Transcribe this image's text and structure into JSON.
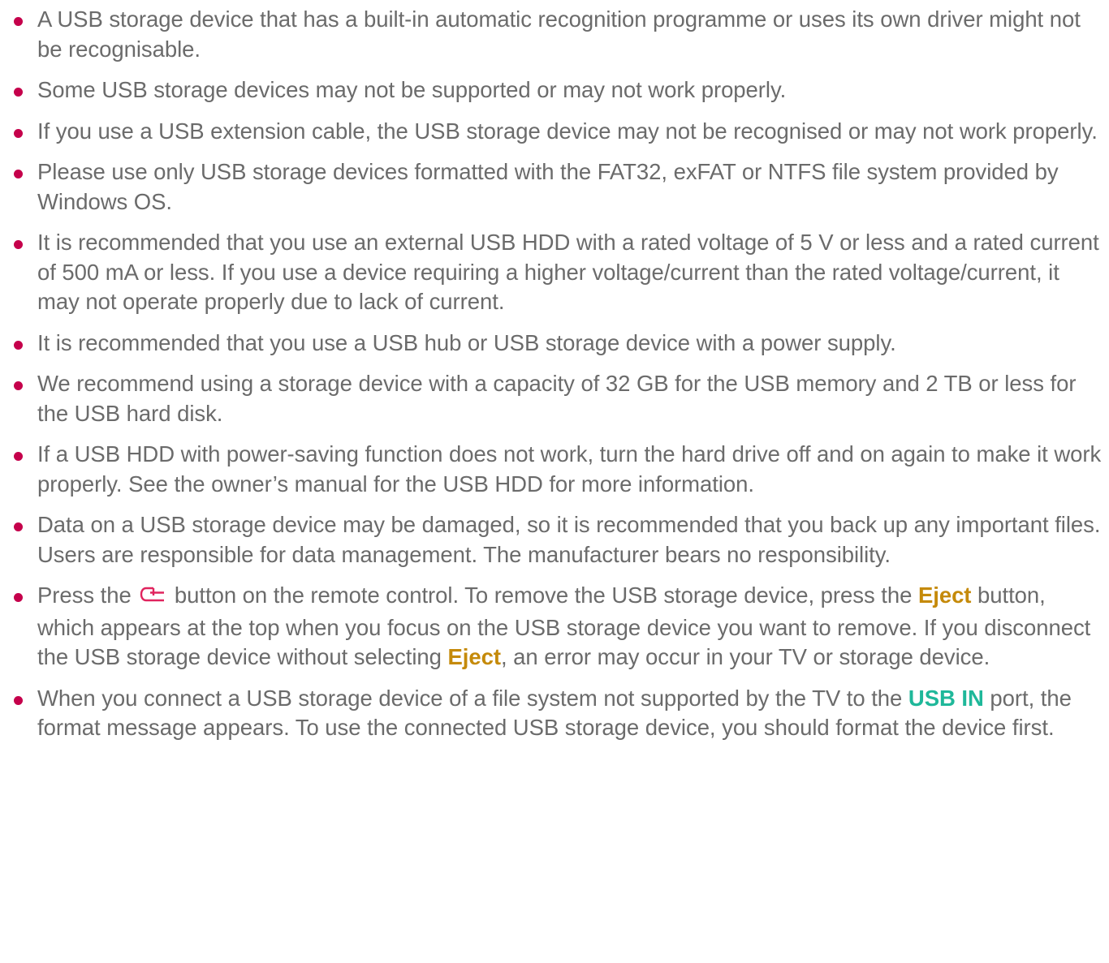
{
  "notes": [
    {
      "text": "A USB storage device that has a built-in automatic recognition programme or uses its own driver might not be recognisable."
    },
    {
      "text": "Some USB storage devices may not be supported or may not work properly."
    },
    {
      "text": "If you use a USB extension cable, the USB storage device may not be recognised or may not work properly."
    },
    {
      "text": "Please use only USB storage devices formatted with the FAT32, exFAT or NTFS file system provided by Windows OS."
    },
    {
      "text": "It is recommended that you use an external USB HDD with a rated voltage of 5 V or less and a rated current of 500 mA or less. If you use a device requiring a higher voltage/current than the rated voltage/current, it may not operate properly due to lack of current."
    },
    {
      "text": "It is recommended that you use a USB hub or USB storage device with a power supply."
    },
    {
      "text": "We recommend using a storage device with a capacity of 32 GB for the USB memory and 2 TB or less for the USB hard disk."
    },
    {
      "text": "If a USB HDD with power-saving function does not work, turn the hard drive off and on again to make it work properly. See the owner’s manual for the USB HDD for more information."
    },
    {
      "text": "Data on a USB storage device may be damaged, so it is recommended that you back up any important files. Users are responsible for data management. The manufacturer bears no responsibility."
    },
    {
      "part1": "Press the",
      "icon": "input-source-icon",
      "part2": "button on the remote control. To remove the USB storage device, press the",
      "eject1": "Eject",
      "part3": "button, which appears at the top when you focus on the USB storage device you want to remove. If you disconnect the USB storage device without selecting",
      "eject2": "Eject",
      "part4": ", an error may occur in your TV or storage device."
    },
    {
      "part1": "When you connect a USB storage device of a file system not supported by the TV to the",
      "port": "USB IN",
      "part2": "port, the format message appears. To use the connected USB storage device, you should format the device first."
    }
  ],
  "colors": {
    "bullet": "#c5004b",
    "text": "#6b6b6b",
    "eject": "#c58a0a",
    "usb_in": "#1fb89a",
    "icon": "#e0245e"
  }
}
